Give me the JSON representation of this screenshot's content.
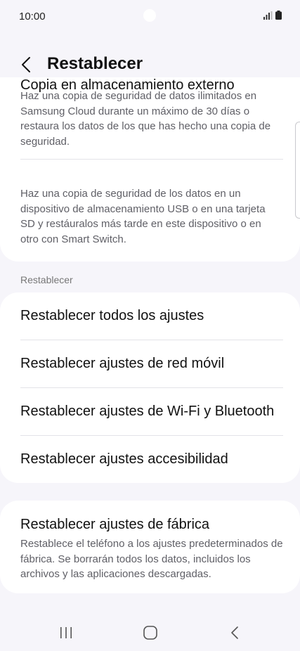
{
  "status_bar": {
    "time": "10:00"
  },
  "header": {
    "title": "Restablecer"
  },
  "backup_card": {
    "cloud_desc": "Haz una copia de seguridad de datos ilimitados en Samsung Cloud durante un máximo de 30 días o restaura los datos de los que has hecho una copia de seguridad.",
    "external_title": "Copia en almacenamiento externo",
    "external_desc": "Haz una copia de seguridad de los datos en un dispositivo de almacenamiento USB o en una tarjeta SD y restáuralos más tarde en este dispositivo o en otro con Smart Switch."
  },
  "reset_section": {
    "label": "Restablecer",
    "items": [
      {
        "label": "Restablecer todos los ajustes"
      },
      {
        "label": "Restablecer ajustes de red móvil"
      },
      {
        "label": "Restablecer ajustes de Wi-Fi y Bluetooth"
      },
      {
        "label": "Restablecer ajustes accesibilidad"
      }
    ]
  },
  "factory_card": {
    "title": "Restablecer ajustes de fábrica",
    "desc": "Restablece el teléfono a los ajustes predeterminados de fábrica. Se borrarán todos los datos, incluidos los archivos y las aplicaciones descargadas."
  },
  "icons": {
    "back": "chevron-left-icon",
    "signal": "signal-icon",
    "battery": "battery-icon",
    "nav_recents": "recents-icon",
    "nav_home": "home-icon",
    "nav_back": "back-icon"
  }
}
